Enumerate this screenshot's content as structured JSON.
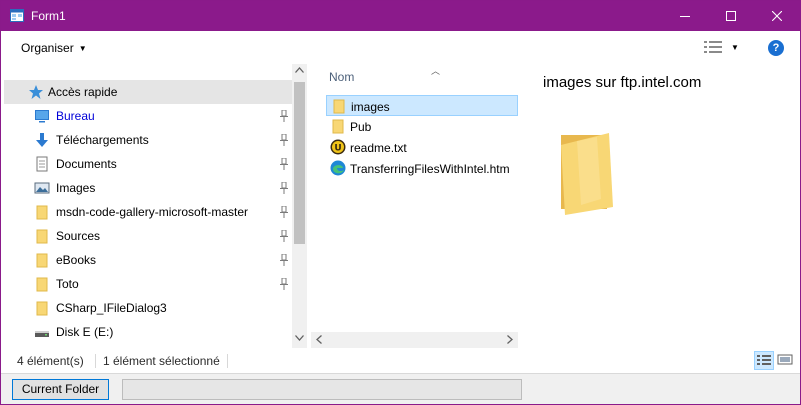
{
  "window": {
    "title": "Form1"
  },
  "toolbar": {
    "organise_label": "Organiser"
  },
  "nav": {
    "items": [
      {
        "label": "Accès rapide",
        "icon": "star-icon",
        "pinned": false
      },
      {
        "label": "Bureau",
        "icon": "desktop-icon",
        "pinned": true
      },
      {
        "label": "Téléchargements",
        "icon": "download-icon",
        "pinned": true
      },
      {
        "label": "Documents",
        "icon": "documents-icon",
        "pinned": true
      },
      {
        "label": "Images",
        "icon": "images-icon",
        "pinned": true
      },
      {
        "label": "msdn-code-gallery-microsoft-master",
        "icon": "folder-icon",
        "pinned": true
      },
      {
        "label": "Sources",
        "icon": "folder-icon",
        "pinned": true
      },
      {
        "label": "eBooks",
        "icon": "folder-icon",
        "pinned": true
      },
      {
        "label": "Toto",
        "icon": "folder-icon",
        "pinned": true
      },
      {
        "label": "CSharp_IFileDialog3",
        "icon": "folder-icon",
        "pinned": false
      },
      {
        "label": "Disk E (E:)",
        "icon": "drive-icon",
        "pinned": false
      }
    ]
  },
  "filelist": {
    "column_header": "Nom",
    "files": [
      {
        "name": "images",
        "icon": "folder-icon"
      },
      {
        "name": "Pub",
        "icon": "folder-icon"
      },
      {
        "name": "readme.txt",
        "icon": "text-file-icon"
      },
      {
        "name": "TransferringFilesWithIntel.htm",
        "icon": "edge-html-icon"
      }
    ]
  },
  "preview": {
    "title": "images sur ftp.intel.com"
  },
  "status": {
    "count": "4 élément(s)",
    "selection": "1 élément sélectionné"
  },
  "form": {
    "current_folder_label": "Current Folder",
    "progress": 0
  },
  "colors": {
    "titlebar": "#8b1a8b",
    "selection": "#cce8ff",
    "folder": "#f8d775"
  }
}
